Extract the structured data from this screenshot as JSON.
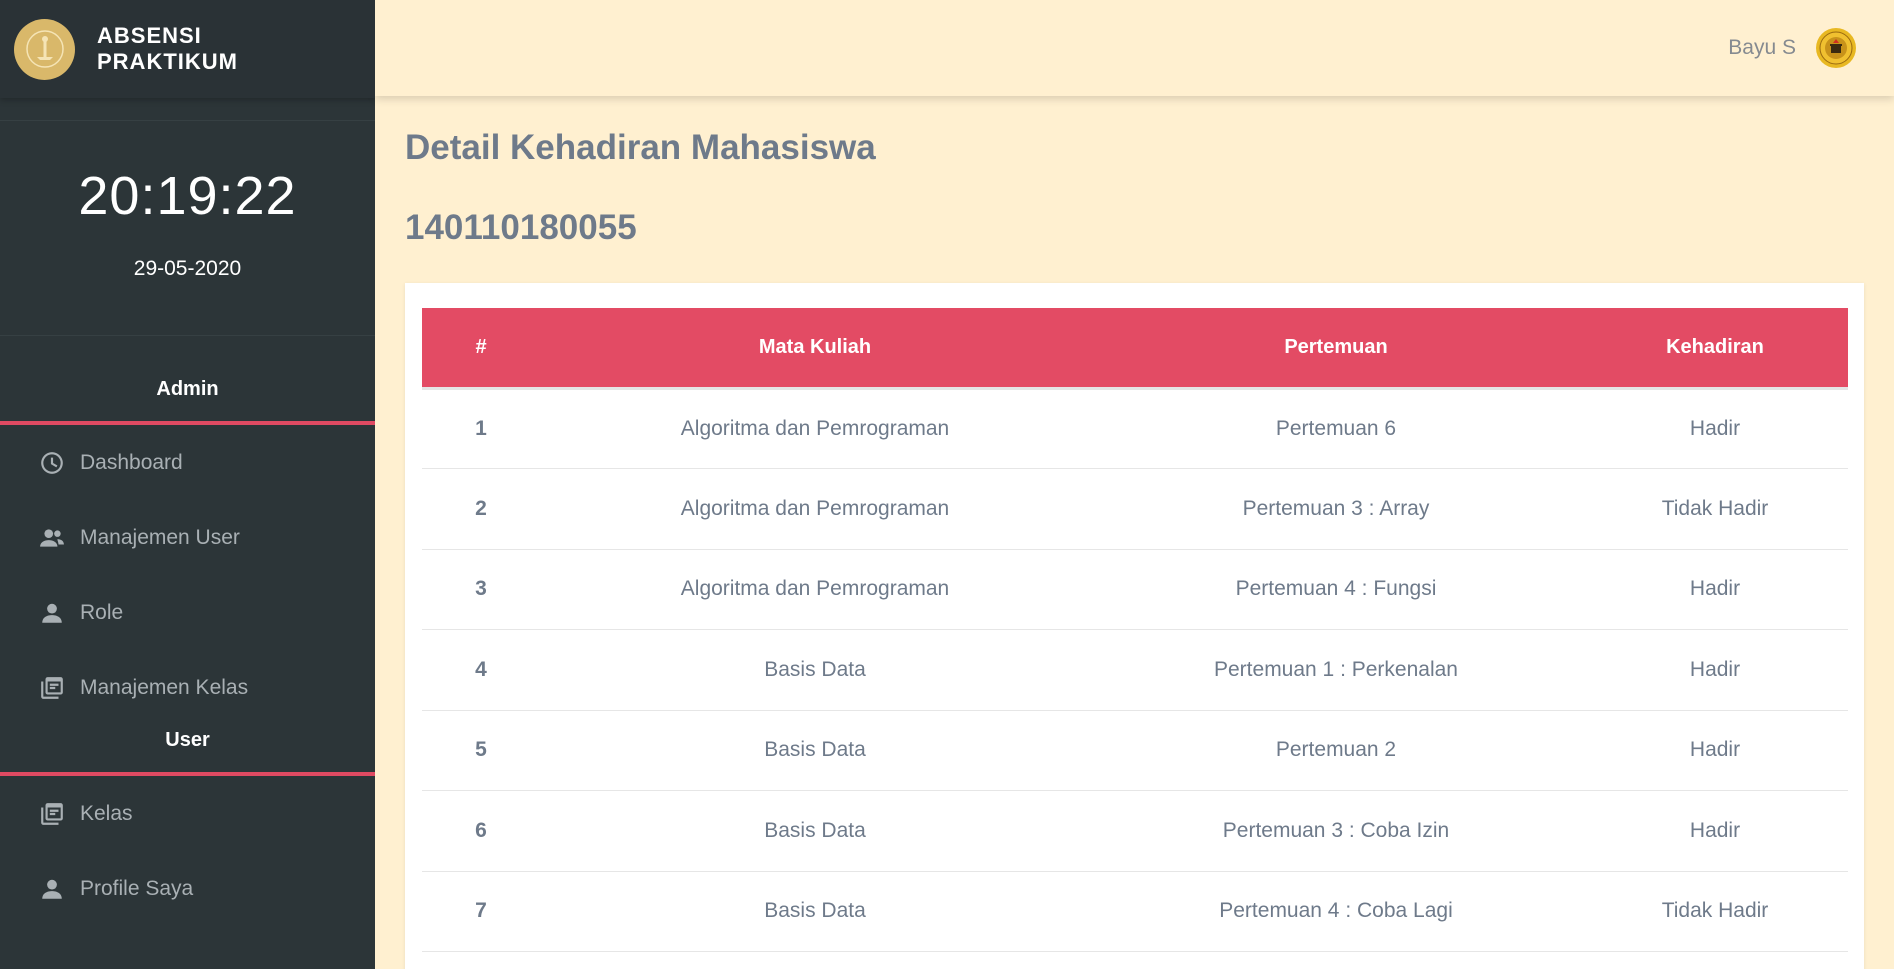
{
  "brand": {
    "title_line1": "ABSENSI",
    "title_line2": "PRAKTIKUM"
  },
  "clock": {
    "time": "20:19:22",
    "date": "29-05-2020"
  },
  "sidebar": {
    "admin_heading": "Admin",
    "admin_items": [
      {
        "label": "Dashboard",
        "icon": "dashboard-icon"
      },
      {
        "label": "Manajemen User",
        "icon": "users-icon"
      },
      {
        "label": "Role",
        "icon": "person-icon"
      },
      {
        "label": "Manajemen Kelas",
        "icon": "class-icon"
      }
    ],
    "user_heading": "User",
    "user_items": [
      {
        "label": "Kelas",
        "icon": "class-icon"
      },
      {
        "label": "Profile Saya",
        "icon": "person-icon"
      }
    ]
  },
  "topbar": {
    "user_name": "Bayu S",
    "avatar_icon": "university-logo-icon"
  },
  "page": {
    "title": "Detail Kehadiran Mahasiswa",
    "student_id": "140110180055"
  },
  "table": {
    "headers": [
      "#",
      "Mata Kuliah",
      "Pertemuan",
      "Kehadiran"
    ],
    "rows": [
      [
        "1",
        "Algoritma dan Pemrograman",
        "Pertemuan 6",
        "Hadir"
      ],
      [
        "2",
        "Algoritma dan Pemrograman",
        "Pertemuan 3 : Array",
        "Tidak Hadir"
      ],
      [
        "3",
        "Algoritma dan Pemrograman",
        "Pertemuan 4 : Fungsi",
        "Hadir"
      ],
      [
        "4",
        "Basis Data",
        "Pertemuan 1 : Perkenalan",
        "Hadir"
      ],
      [
        "5",
        "Basis Data",
        "Pertemuan 2",
        "Hadir"
      ],
      [
        "6",
        "Basis Data",
        "Pertemuan 3 : Coba Izin",
        "Hadir"
      ],
      [
        "7",
        "Basis Data",
        "Pertemuan 4 : Coba Lagi",
        "Tidak Hadir"
      ]
    ]
  },
  "colors": {
    "sidebar_bg": "#2c3538",
    "accent": "#e34b64",
    "page_bg": "#fff0d0",
    "text": "#6e7a8a"
  }
}
